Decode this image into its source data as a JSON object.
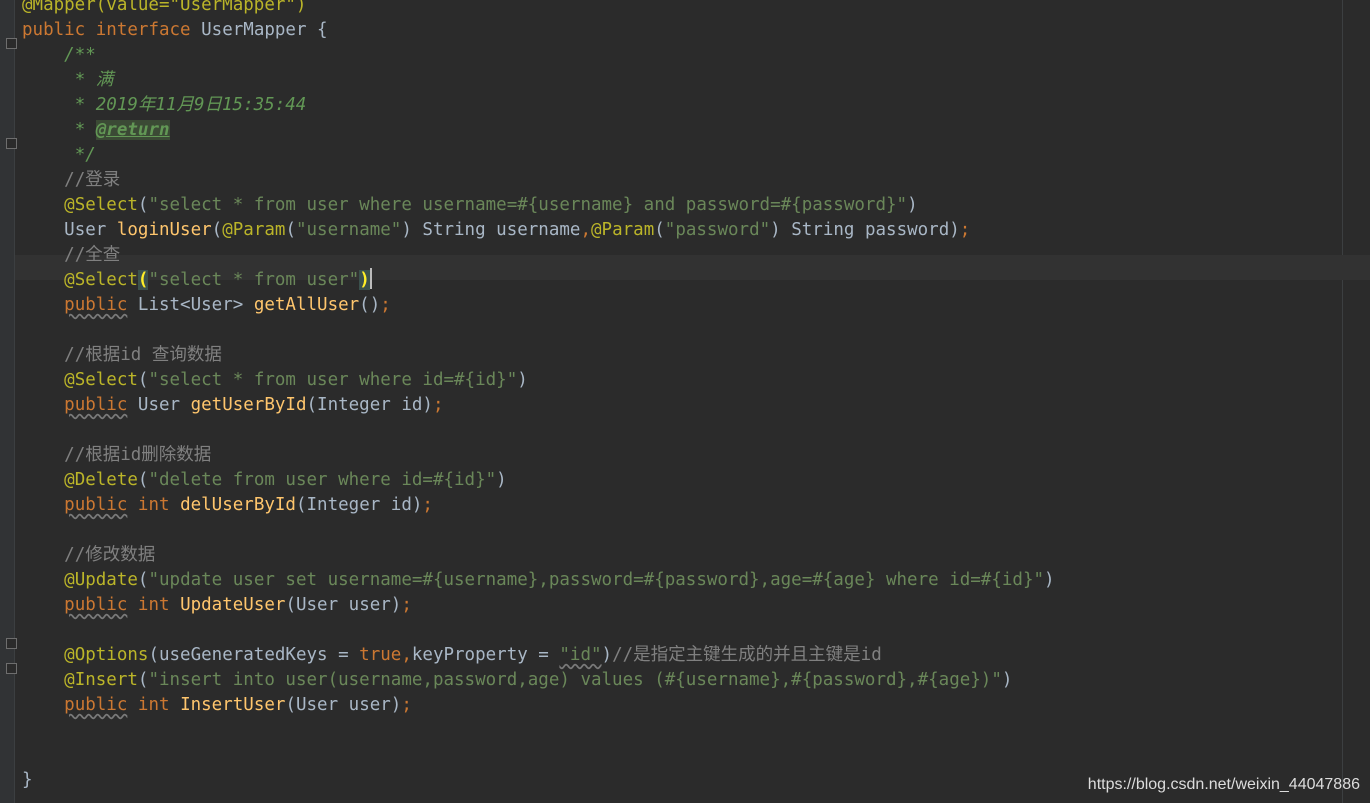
{
  "code": {
    "l0": "@Mapper(value=\"UserMapper\")",
    "l1_kw1": "public",
    "l1_kw2": "interface",
    "l1_name": "UserMapper {",
    "l2": "/**",
    "l3": " * 满",
    "l4": " * 2019年11月9日15:35:44",
    "l5_star": " * ",
    "l5_tag": "@return",
    "l6": " */",
    "l7": "//登录",
    "l8_ann": "@Select",
    "l8_str": "\"select * from user where username=#{username} and password=#{password}\"",
    "l9_type": "User ",
    "l9_fn": "loginUser",
    "l9_ann1": "@Param",
    "l9_str1": "\"username\"",
    "l9_mid": ") String username",
    "l9_ann2": "@Param",
    "l9_str2": "\"password\"",
    "l9_end": ") String password)",
    "l10": "//全查",
    "l11_ann": "@Select",
    "l11_str": "\"select * from user\"",
    "l12_kw": "public",
    "l12_type": " List<User> ",
    "l12_fn": "getAllUser",
    "l14": "//根据id 查询数据",
    "l15_ann": "@Select",
    "l15_str": "\"select * from user where id=#{id}\"",
    "l16_kw": "public",
    "l16_type": " User ",
    "l16_fn": "getUserById",
    "l16_params": "(Integer id)",
    "l18": "//根据id删除数据",
    "l19_ann": "@Delete",
    "l19_str": "\"delete from user where id=#{id}\"",
    "l20_kw": "public",
    "l20_kw2": "int",
    "l20_fn": "delUserById",
    "l20_params": "(Integer id)",
    "l22": "//修改数据",
    "l23_ann": "@Update",
    "l23_str": "\"update user set username=#{username},password=#{password},age=#{age} where id=#{id}\"",
    "l24_kw": "public",
    "l24_kw2": "int",
    "l24_fn": "UpdateUser",
    "l24_params": "(User user)",
    "l26_ann": "@Options",
    "l26_p1": "(useGeneratedKeys = ",
    "l26_true": "true",
    "l26_p2": "keyProperty = ",
    "l26_str": "\"id\"",
    "l26_cm": "//是指定主键生成的并且主键是id",
    "l27_ann": "@Insert",
    "l27_str": "\"insert into user(username,password,age) values (#{username},#{password},#{age})\"",
    "l28_kw": "public",
    "l28_kw2": "int",
    "l28_fn": "InsertUser",
    "l28_params": "(User user)",
    "l31": "}"
  },
  "watermark": "https://blog.csdn.net/weixin_44047886",
  "colors": {
    "background": "#2b2b2b",
    "keyword": "#cc7832",
    "annotation": "#bbb529",
    "string": "#6a8759",
    "comment": "#808080",
    "doc_comment": "#629755",
    "method": "#ffc66d",
    "text": "#a9b7c6"
  }
}
